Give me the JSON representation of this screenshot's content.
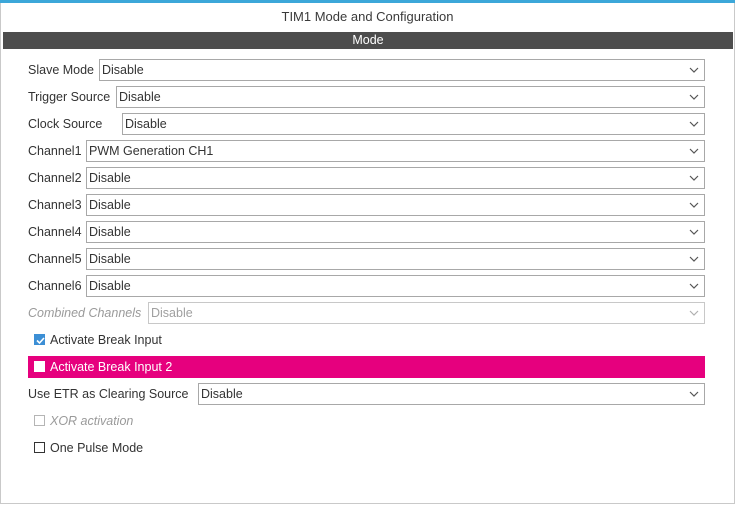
{
  "window": {
    "title": "TIM1 Mode and Configuration"
  },
  "section": {
    "title": "Mode"
  },
  "colors": {
    "highlight": "#e6007e",
    "header_bar": "#4d4d4d",
    "accent": "#3ca7d9"
  },
  "fields": [
    {
      "label": "Slave Mode",
      "value": "Disable"
    },
    {
      "label": "Trigger Source",
      "value": "Disable"
    },
    {
      "label": "Clock Source",
      "value": "Disable"
    },
    {
      "label": "Channel1",
      "value": "PWM Generation CH1"
    },
    {
      "label": "Channel2",
      "value": "Disable"
    },
    {
      "label": "Channel3",
      "value": "Disable"
    },
    {
      "label": "Channel4",
      "value": "Disable"
    },
    {
      "label": "Channel5",
      "value": "Disable"
    },
    {
      "label": "Channel6",
      "value": "Disable"
    },
    {
      "label": "Combined Channels",
      "value": "Disable",
      "enabled": false
    }
  ],
  "checkboxes": [
    {
      "label": "Activate Break Input",
      "checked": true
    },
    {
      "label": "Activate Break Input 2",
      "checked": false,
      "highlighted": true
    }
  ],
  "etr": {
    "label": "Use ETR as Clearing Source",
    "value": "Disable"
  },
  "checkboxes2": [
    {
      "label": "XOR activation",
      "checked": false,
      "enabled": false
    },
    {
      "label": "One Pulse Mode",
      "checked": false
    }
  ]
}
